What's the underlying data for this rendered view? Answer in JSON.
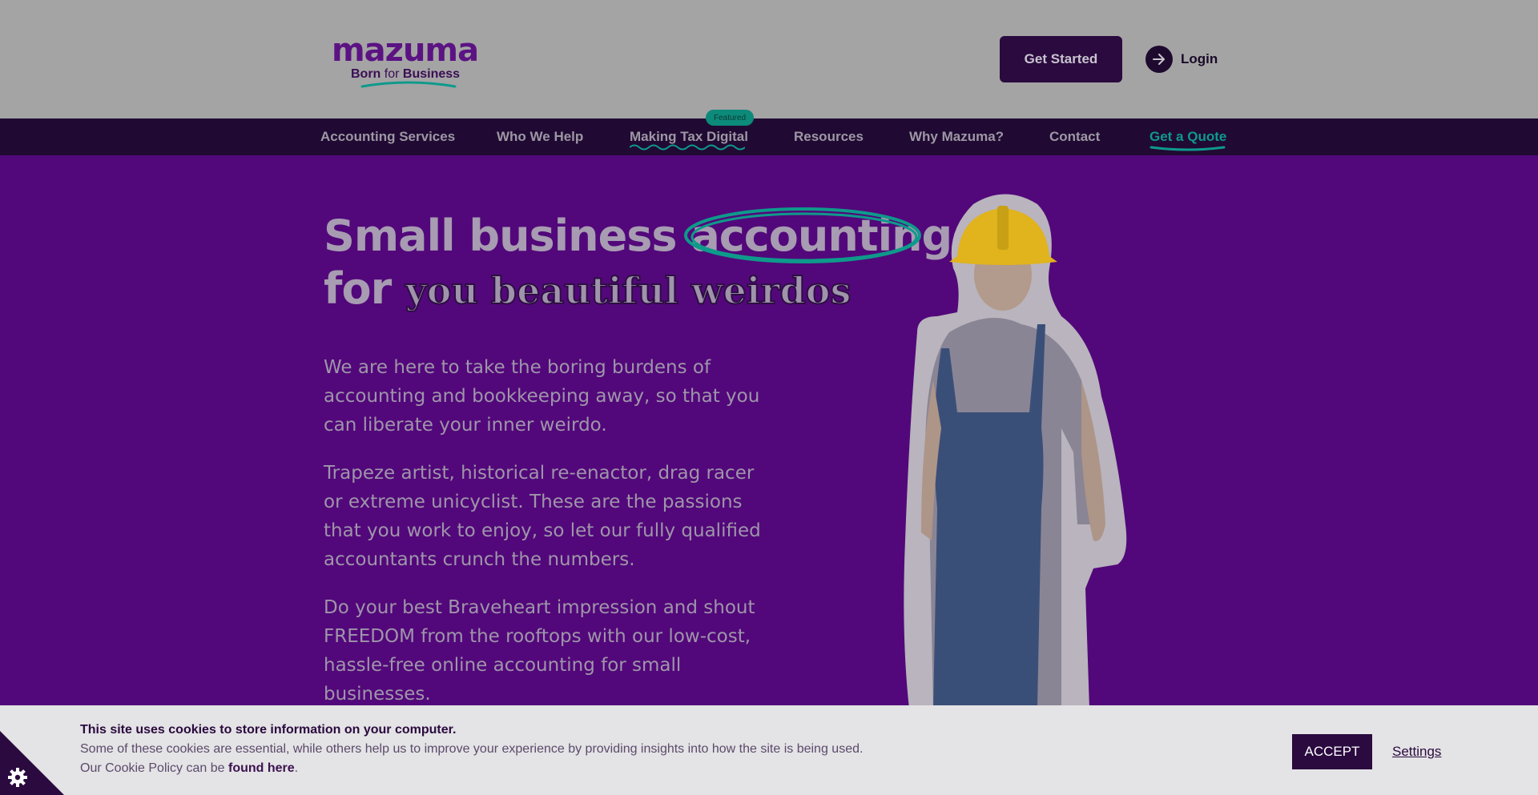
{
  "header": {
    "logo": {
      "wordmark": "mazuma",
      "tagline_a": "Born",
      "tagline_for": "for",
      "tagline_b": "Business"
    },
    "get_started_label": "Get Started",
    "login_label": "Login"
  },
  "nav": {
    "items": [
      {
        "label": "Accounting Services"
      },
      {
        "label": "Who We Help"
      },
      {
        "label": "Making Tax Digital"
      },
      {
        "label": "Resources"
      },
      {
        "label": "Why Mazuma?"
      },
      {
        "label": "Contact"
      },
      {
        "label": "Get a Quote"
      }
    ],
    "featured_badge": "Featured"
  },
  "hero": {
    "headline_part1": "Small business ",
    "headline_highlight": "accounting",
    "headline_line2_prefix": "for ",
    "headline_weird": "you beautiful weirdos",
    "paragraphs": [
      "We are here to take the boring burdens of accounting and bookkeeping away, so that you can liberate your inner weirdo.",
      "Trapeze artist, historical re-enactor, drag racer or extreme unicyclist. These are the passions that you work to enjoy, so let our fully qualified accountants crunch the numbers.",
      "Do your best Braveheart impression and shout FREEDOM from the rooftops with our low-cost, hassle-free online accounting for small businesses."
    ]
  },
  "cookie": {
    "title": "This site uses cookies to store information on your computer.",
    "line1": "Some of these cookies are essential, while others help us to improve your experience by providing insights into how the site is being used.",
    "line2_prefix": "Our Cookie Policy can be ",
    "line2_link": "found here",
    "line2_suffix": ".",
    "accept_label": "ACCEPT",
    "settings_label": "Settings"
  },
  "colors": {
    "brand_purple": "#52087a",
    "dark_purple": "#2a0a3f",
    "teal_accent": "#0e9a8b",
    "header_grey": "#a4a4a4"
  },
  "icons": {
    "login": "arrow-right-icon",
    "cookie_settings": "gear-icon"
  }
}
